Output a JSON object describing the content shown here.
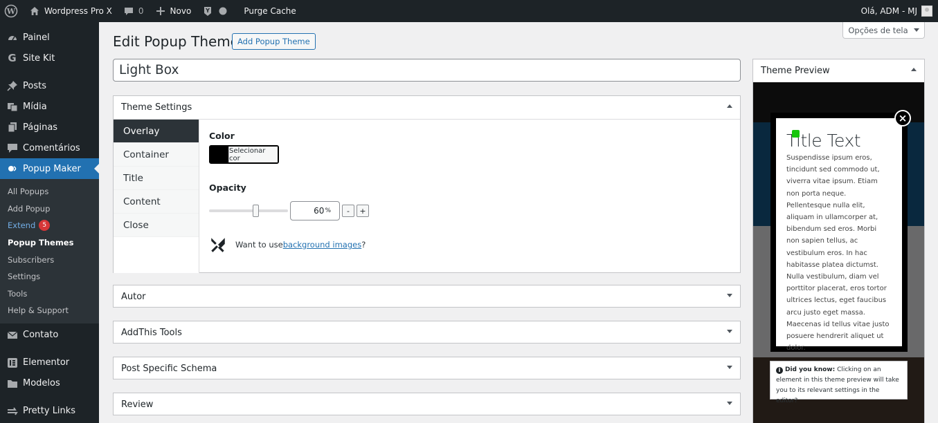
{
  "adminbar": {
    "site_name": "Wordpress Pro X",
    "comments_count": "0",
    "new_label": "Novo",
    "purge_label": "Purge Cache",
    "greeting": "Olá, ADM - MJ"
  },
  "sidebar": {
    "items": [
      {
        "label": "Painel",
        "icon": "dashboard-icon"
      },
      {
        "label": "Site Kit",
        "icon": "google-g-icon"
      },
      {
        "label": "Posts",
        "icon": "pin-icon"
      },
      {
        "label": "Mídia",
        "icon": "media-icon"
      },
      {
        "label": "Páginas",
        "icon": "pages-icon"
      },
      {
        "label": "Comentários",
        "icon": "comment-icon"
      },
      {
        "label": "Popup Maker",
        "icon": "popup-maker-icon"
      }
    ],
    "submenu": [
      {
        "label": "All Popups"
      },
      {
        "label": "Add Popup"
      },
      {
        "label": "Extend",
        "badge": "5"
      },
      {
        "label": "Popup Themes"
      },
      {
        "label": "Subscribers"
      },
      {
        "label": "Settings"
      },
      {
        "label": "Tools"
      },
      {
        "label": "Help & Support"
      }
    ],
    "items_after": [
      {
        "label": "Contato",
        "icon": "mail-icon"
      },
      {
        "label": "Elementor",
        "icon": "elementor-icon"
      },
      {
        "label": "Modelos",
        "icon": "folder-icon"
      },
      {
        "label": "Pretty Links",
        "icon": "link-icon"
      }
    ]
  },
  "header": {
    "title": "Edit Popup Theme",
    "add_button": "Add Popup Theme",
    "screen_options": "Opções de tela"
  },
  "theme_title_value": "Light Box",
  "theme_settings": {
    "heading": "Theme Settings",
    "tabs": [
      "Overlay",
      "Container",
      "Title",
      "Content",
      "Close"
    ],
    "active_tab": "Overlay",
    "color_label": "Color",
    "color_button": "Selecionar cor",
    "color_value": "#000000",
    "opacity_label": "Opacity",
    "opacity_value": "60",
    "opacity_unit": "%",
    "minus_label": "-",
    "plus_label": "+",
    "bg_prompt": "Want to use ",
    "bg_link": "background images",
    "bg_suffix": "?"
  },
  "boxes": [
    "Autor",
    "AddThis Tools",
    "Post Specific Schema",
    "Review"
  ],
  "preview": {
    "heading": "Theme Preview",
    "popup_title": "Title Text",
    "popup_body": "Suspendisse ipsum eros, tincidunt sed commodo ut, viverra vitae ipsum. Etiam non porta neque. Pellentesque nulla elit, aliquam in ullamcorper at, bibendum sed eros. Morbi non sapien tellus, ac vestibulum eros. In hac habitasse platea dictumst. Nulla vestibulum, diam vel porttitor placerat, eros tortor ultrices lectus, eget faucibus arcu justo eget massa. Maecenas id tellus vitae justo posuere hendrerit aliquet ut dolor.",
    "close_glyph": "×",
    "tip_bold": "Did you know:",
    "tip_text": " Clicking on an element in this theme preview will take you to its relevant settings in the editor?"
  }
}
